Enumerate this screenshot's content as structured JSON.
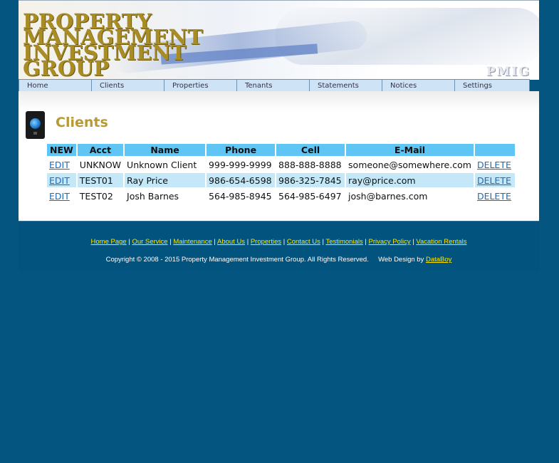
{
  "logo": {
    "lines": [
      "PROPERTY",
      "MANAGEMENT",
      "INVESTMENT",
      "GROUP"
    ],
    "monogram": "PMIG"
  },
  "nav": [
    "Home",
    "Clients",
    "Properties",
    "Tenants",
    "Statements",
    "Notices",
    "Settings"
  ],
  "page_title": "Clients",
  "table": {
    "headers": [
      "NEW",
      "Acct",
      "Name",
      "Phone",
      "Cell",
      "E-Mail",
      ""
    ],
    "rows": [
      {
        "edit": "EDIT",
        "acct": "UNKNOW",
        "name": "Unknown Client",
        "phone": "999-999-9999",
        "cell": "888-888-8888",
        "email": "someone@somewhere.com",
        "delete": "DELETE"
      },
      {
        "edit": "EDIT",
        "acct": "TEST01",
        "name": "Ray Price",
        "phone": "986-654-6598",
        "cell": "986-325-7845",
        "email": "ray@price.com",
        "delete": "DELETE"
      },
      {
        "edit": "EDIT",
        "acct": "TEST02",
        "name": "Josh Barnes",
        "phone": "564-985-8945",
        "cell": "564-985-6497",
        "email": "josh@barnes.com",
        "delete": "DELETE"
      }
    ]
  },
  "footer": {
    "links": [
      "Home Page",
      "Our Service",
      "Maintenance",
      "About Us",
      "Properties",
      "Contact Us",
      "Testimonials",
      "Privacy Policy",
      "Vacation Rentals"
    ],
    "copyright": "Copyright © 2008 - 2015 Property Management Investment Group. All Rights Reserved.",
    "webdesign_prefix": "Web Design by",
    "webdesign_link": "DataBoy"
  },
  "colors": {
    "background": "#04557f",
    "title": "#b79a36",
    "header_cell": "#5fc5f5",
    "alt_row": "#c4e8f7",
    "footer_link": "#ffe600"
  }
}
